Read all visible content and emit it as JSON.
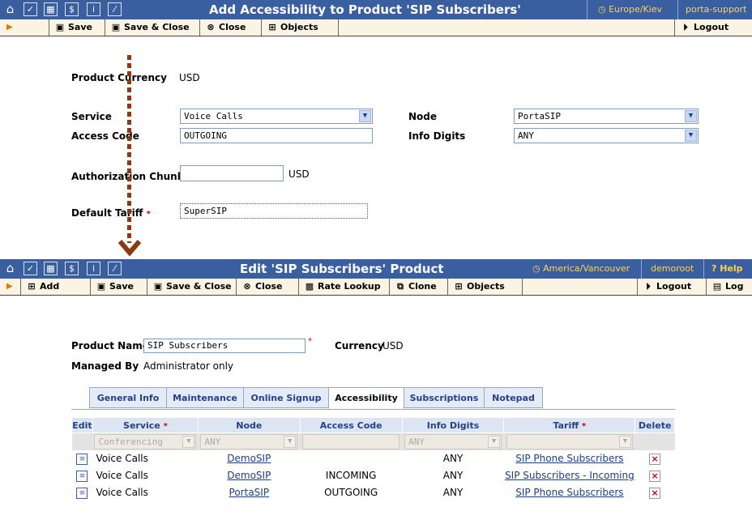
{
  "top": {
    "title": "Add Accessibility to Product 'SIP Subscribers'",
    "timezone": "Europe/Kiev",
    "user": "porta-support",
    "toolbar": {
      "save": "Save",
      "save_close": "Save & Close",
      "close": "Close",
      "objects": "Objects",
      "logout": "Logout"
    },
    "form": {
      "product_currency_label": "Product Currency",
      "product_currency_value": "USD",
      "service_label": "Service",
      "service_value": "Voice Calls",
      "node_label": "Node",
      "node_value": "PortaSIP",
      "access_code_label": "Access Code",
      "access_code_value": "OUTGOING",
      "info_digits_label": "Info Digits",
      "info_digits_value": "ANY",
      "auth_chunk_label": "Authorization Chunk",
      "auth_chunk_value": "",
      "auth_chunk_unit": "USD",
      "default_tariff_label": "Default Tariff",
      "default_tariff_value": "SuperSIP",
      "required_mark": "*"
    }
  },
  "bottom": {
    "title": "Edit 'SIP Subscribers' Product",
    "timezone": "America/Vancouver",
    "user": "demoroot",
    "help": "Help",
    "toolbar": {
      "add": "Add",
      "save": "Save",
      "save_close": "Save & Close",
      "close": "Close",
      "rate_lookup": "Rate Lookup",
      "clone": "Clone",
      "objects": "Objects",
      "logout": "Logout",
      "log": "Log"
    },
    "product_name_label": "Product Name",
    "product_name_value": "SIP Subscribers",
    "currency_label": "Currency",
    "currency_value": "USD",
    "managed_by_label": "Managed By",
    "managed_by_value": "Administrator only",
    "required_mark": "*",
    "tabs": [
      "General Info",
      "Maintenance",
      "Online Signup",
      "Accessibility",
      "Subscriptions",
      "Notepad"
    ],
    "table": {
      "headers": [
        "Edit",
        "Service",
        "Node",
        "Access Code",
        "Info Digits",
        "Tariff",
        "Delete"
      ],
      "filter": {
        "service": "Conferencing",
        "node": "ANY",
        "access_code": "",
        "info_digits": "ANY",
        "tariff": ""
      },
      "rows": [
        {
          "service": "Voice Calls",
          "node": "DemoSIP",
          "access_code": "",
          "info_digits": "ANY",
          "tariff": "SIP Phone Subscribers"
        },
        {
          "service": "Voice Calls",
          "node": "DemoSIP",
          "access_code": "INCOMING",
          "info_digits": "ANY",
          "tariff": "SIP Subscribers - Incoming"
        },
        {
          "service": "Voice Calls",
          "node": "PortaSIP",
          "access_code": "OUTGOING",
          "info_digits": "ANY",
          "tariff": "SIP Phone Subscribers"
        }
      ]
    }
  },
  "icons": [
    "home-icon",
    "checkbox-icon",
    "calculator-icon",
    "dollar-icon",
    "info-icon",
    "chart-icon",
    "save-icon",
    "close-icon",
    "objects-icon",
    "logout-icon",
    "add-icon",
    "rate-lookup-icon",
    "clone-icon",
    "log-icon",
    "edit-icon",
    "delete-icon",
    "arrow-down-icon"
  ],
  "colors": {
    "titlebar": "#3a5fa0",
    "toolbar": "#fbf4e3",
    "accent": "#ffd24a",
    "arrow": "#8b3a12",
    "required": "#d00000"
  }
}
